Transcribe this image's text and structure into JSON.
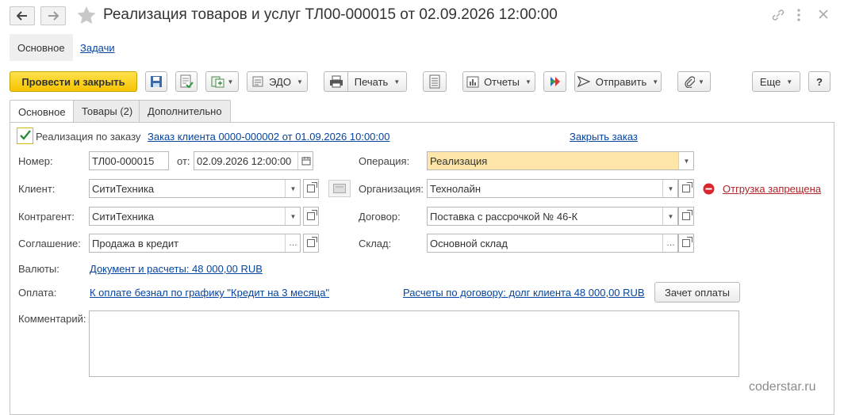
{
  "window": {
    "title": "Реализация товаров и услуг ТЛ00-000015 от 02.09.2026 12:00:00"
  },
  "sections": {
    "main": "Основное",
    "tasks": "Задачи"
  },
  "toolbar": {
    "post_close": "Провести и закрыть",
    "edo": "ЭДО",
    "print": "Печать",
    "reports": "Отчеты",
    "send": "Отправить",
    "more": "Еще",
    "help": "?"
  },
  "tabs": [
    "Основное",
    "Товары (2)",
    "Дополнительно"
  ],
  "form": {
    "by_order_label": "Реализация по заказу",
    "by_order_checked": true,
    "order_link": "Заказ клиента 0000-000002 от 01.09.2026 10:00:00",
    "close_order": "Закрыть заказ",
    "number_label": "Номер:",
    "number": "ТЛ00-000015",
    "date_label": "от:",
    "date": "02.09.2026 12:00:00",
    "operation_label": "Операция:",
    "operation": "Реализация",
    "client_label": "Клиент:",
    "client": "СитиТехника",
    "org_label": "Организация:",
    "org": "Технолайн",
    "shipping_forbidden": "Отгрузка запрещена",
    "counterparty_label": "Контрагент:",
    "counterparty": "СитиТехника",
    "contract_label": "Договор:",
    "contract": "Поставка с рассрочкой № 46-К",
    "agreement_label": "Соглашение:",
    "agreement": "Продажа в кредит",
    "warehouse_label": "Склад:",
    "warehouse": "Основной склад",
    "currency_label": "Валюты:",
    "currency_link": "Документ и расчеты: 48 000,00 RUB",
    "payment_label": "Оплата:",
    "payment_link": "К оплате безнал по графику \"Кредит на 3 месяца\"",
    "settlements_link": "Расчеты по договору: долг клиента 48 000,00 RUB",
    "offset_button": "Зачет оплаты",
    "comment_label": "Комментарий:",
    "comment": ""
  },
  "watermark": "coderstar.ru",
  "colors": {
    "primary_button": "#f5c400",
    "operation_field": "#fde6a8",
    "link": "#0645a0",
    "warning_link": "#b0232a",
    "warning_icon": "#d9262c"
  }
}
